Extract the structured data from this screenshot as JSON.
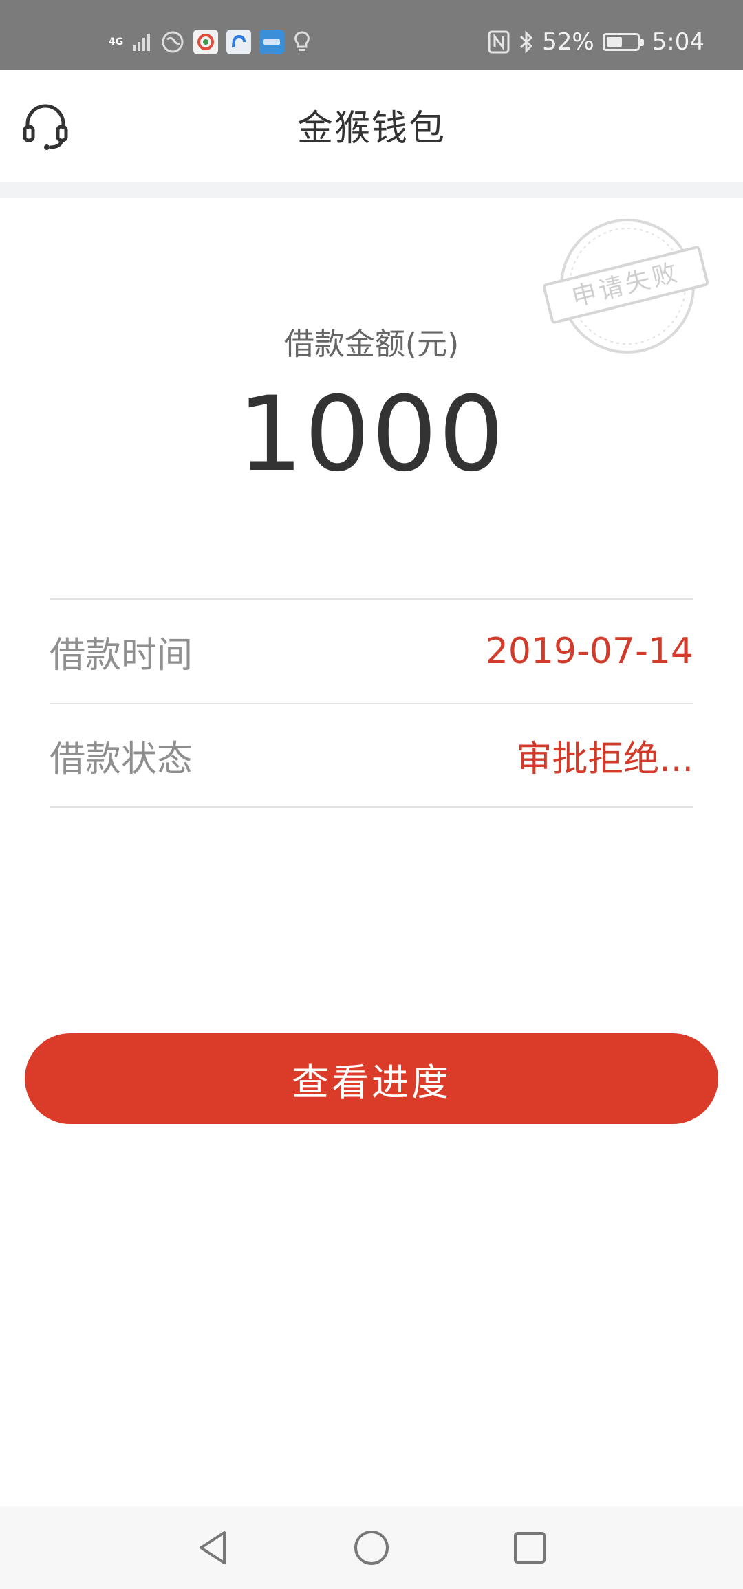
{
  "status_bar": {
    "network_top": "4G",
    "network_bottom": "4G",
    "battery_percent": "52%",
    "battery_level": 0.52,
    "time": "5:04",
    "icons": [
      "signal-icon",
      "globe-icon",
      "app-icon-1",
      "app-icon-2",
      "app-icon-3",
      "bulb-icon",
      "nfc-icon",
      "bluetooth-icon",
      "battery-icon"
    ]
  },
  "header": {
    "title": "金猴钱包",
    "support_icon": "headset-icon"
  },
  "stamp": {
    "text": "申请失败"
  },
  "loan": {
    "amount_label": "借款金额(元)",
    "amount_value": "1000",
    "rows": [
      {
        "label": "借款时间",
        "value": "2019-07-14"
      },
      {
        "label": "借款状态",
        "value": "审批拒绝..."
      }
    ]
  },
  "actions": {
    "view_progress": "查看进度"
  },
  "colors": {
    "accent": "#db3c29",
    "value_red": "#d23a2a",
    "status_bar_bg": "#7b7b7b"
  },
  "navigation": {
    "icons": [
      "back-icon",
      "home-icon",
      "recents-icon"
    ]
  }
}
